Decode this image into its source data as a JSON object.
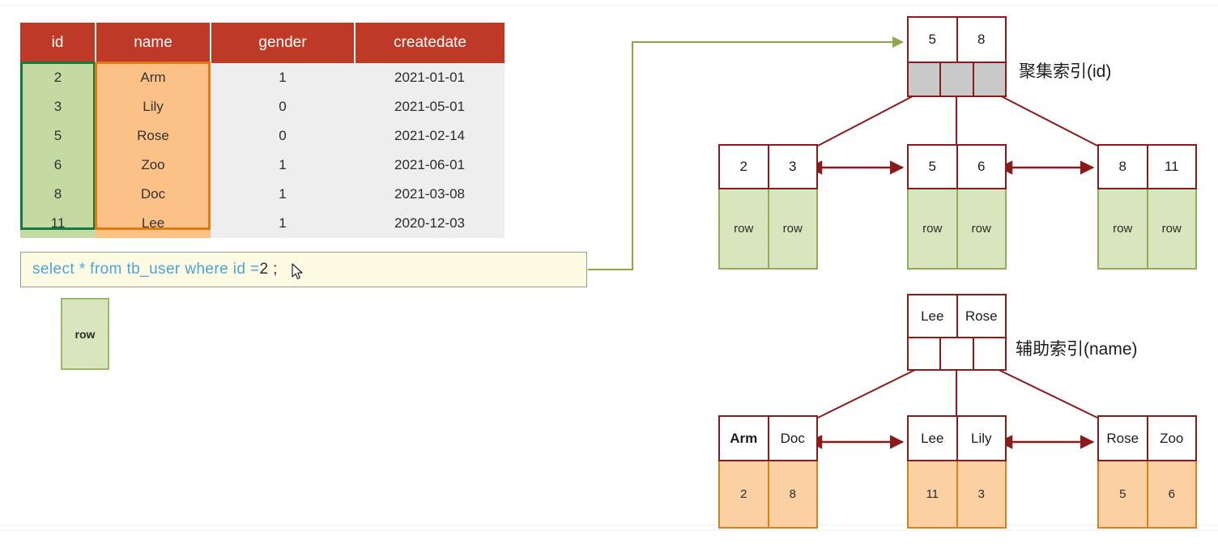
{
  "table": {
    "name": "tb_user",
    "headers": [
      "id",
      "name",
      "gender",
      "createdate"
    ],
    "rows": [
      {
        "id": "2",
        "name": "Arm",
        "gender": "1",
        "createdate": "2021-01-01"
      },
      {
        "id": "3",
        "name": "Lily",
        "gender": "0",
        "createdate": "2021-05-01"
      },
      {
        "id": "5",
        "name": "Rose",
        "gender": "0",
        "createdate": "2021-02-14"
      },
      {
        "id": "6",
        "name": "Zoo",
        "gender": "1",
        "createdate": "2021-06-01"
      },
      {
        "id": "8",
        "name": "Doc",
        "gender": "1",
        "createdate": "2021-03-08"
      },
      {
        "id": "11",
        "name": "Lee",
        "gender": "1",
        "createdate": "2020-12-03"
      }
    ],
    "highlight_id_color": "#12793f",
    "highlight_name_color": "#e07b10",
    "header_color": "#bf3a26"
  },
  "sql": {
    "keyword_part_1": "select * from tb_user where id =",
    "literal_part": "2",
    "terminator": " ;",
    "keyword_color": "#4ba3d3",
    "box_background": "#fdfbe4"
  },
  "detached_row": {
    "label": "row"
  },
  "clustered_index": {
    "caption": "聚集索引(id)",
    "root": {
      "keys": [
        "5",
        "8"
      ],
      "pointer_count": 3,
      "pointer_fill": "#c9c9c9"
    },
    "leaves": [
      {
        "keys": [
          "2",
          "3"
        ],
        "payload": [
          "row",
          "row"
        ]
      },
      {
        "keys": [
          "5",
          "6"
        ],
        "payload": [
          "row",
          "row"
        ]
      },
      {
        "keys": [
          "8",
          "11"
        ],
        "payload": [
          "row",
          "row"
        ]
      }
    ],
    "payload_color": "#d9e5bd"
  },
  "secondary_index": {
    "caption": "辅助索引(name)",
    "root": {
      "keys": [
        "Lee",
        "Rose"
      ],
      "pointer_count": 3,
      "pointer_fill": "#ffffff"
    },
    "leaves": [
      {
        "keys": [
          "Arm",
          "Doc"
        ],
        "bold_keys": [
          true,
          false
        ],
        "payload": [
          "2",
          "8"
        ]
      },
      {
        "keys": [
          "Lee",
          "Lily"
        ],
        "bold_keys": [
          false,
          false
        ],
        "payload": [
          "11",
          "3"
        ]
      },
      {
        "keys": [
          "Rose",
          "Zoo"
        ],
        "bold_keys": [
          false,
          false
        ],
        "payload": [
          "5",
          "6"
        ]
      }
    ],
    "payload_color": "#fbd0a3"
  },
  "connectors": {
    "query_arrow_color": "#8aaa4a",
    "tree_edge_color": "#8b1a1a"
  }
}
